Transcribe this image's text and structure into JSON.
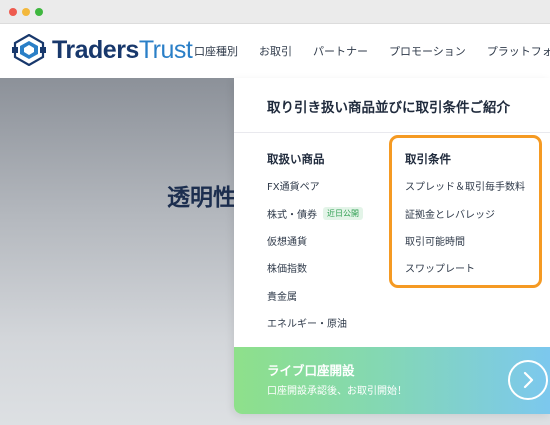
{
  "brand": {
    "name_bold": "Traders",
    "name_light": "Trust"
  },
  "nav": {
    "items": [
      "口座種別",
      "お取引",
      "パートナー",
      "プロモーション",
      "プラットフォー"
    ]
  },
  "hero": {
    "title": "透明性"
  },
  "panel": {
    "title": "取り引き扱い商品並びに取引条件ご紹介",
    "products": {
      "heading": "取扱い商品",
      "items": [
        "FX通貨ペア",
        "株式・債券",
        "仮想通貨",
        "株価指数",
        "貴金属",
        "エネルギー・原油"
      ],
      "badge": "近日公開"
    },
    "conditions": {
      "heading": "取引条件",
      "items": [
        "スプレッド＆取引毎手数料",
        "証拠金とレバレッジ",
        "取引可能時間",
        "スワップレート"
      ]
    },
    "cta": {
      "title": "ライブ口座開設",
      "subtitle": "口座開設承認後、お取引開始！"
    }
  },
  "colors": {
    "brand_navy": "#18386c",
    "highlight_orange": "#f59a23",
    "badge_green": "#2e9e51"
  }
}
